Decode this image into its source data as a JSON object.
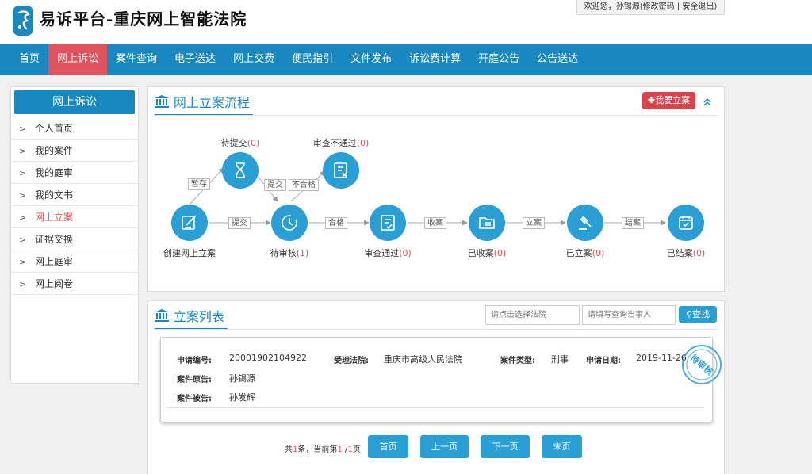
{
  "header": {
    "site_title": "易诉平台-重庆网上智能法院",
    "welcome_prefix": "欢迎您，孙锡源",
    "change_password": "(修改密码",
    "separator": " | ",
    "logout": "安全退出)"
  },
  "nav": {
    "items": [
      "首页",
      "网上诉讼",
      "案件查询",
      "电子送达",
      "网上交费",
      "便民指引",
      "文件发布",
      "诉讼费计算",
      "开庭公告",
      "公告送达"
    ],
    "active_index": 1
  },
  "sidebar": {
    "title": "网上诉讼",
    "items": [
      "个人首页",
      "我的案件",
      "我的庭审",
      "我的文书",
      "网上立案",
      "证据交换",
      "网上庭审",
      "网上阅卷"
    ],
    "active_index": 4
  },
  "flow_panel": {
    "title": "网上立案流程",
    "apply_button": "我要立案",
    "nodes": {
      "create": {
        "label": "创建网上立案",
        "count": ""
      },
      "to_submit": {
        "label": "待提交",
        "count": "(0)"
      },
      "review_fail": {
        "label": "审查不通过",
        "count": "(0)"
      },
      "pending_review": {
        "label": "待审核",
        "count": "(1)"
      },
      "review_pass": {
        "label": "审查通过",
        "count": "(0)"
      },
      "received": {
        "label": "已收案",
        "count": "(0)"
      },
      "filed": {
        "label": "已立案",
        "count": "(0)"
      },
      "closed": {
        "label": "已结案",
        "count": "(0)"
      }
    },
    "edges": {
      "save": "暂存",
      "submit_a": "提交",
      "submit_b": "提交",
      "fail": "不合格",
      "pass": "合格",
      "receive": "收案",
      "file": "立案",
      "close": "结案"
    }
  },
  "list_panel": {
    "title": "立案列表",
    "court_placeholder": "请点击选择法院",
    "party_placeholder": "请填写查询当事人",
    "search_button": "查找",
    "case": {
      "apply_no_label": "申请编号:",
      "apply_no": "20001902104922",
      "court_label": "受理法院:",
      "court": "重庆市高级人民法院",
      "type_label": "案件类型:",
      "type": "刑事",
      "date_label": "申请日期:",
      "date": "2019-11-26",
      "plaintiff_label": "案件原告:",
      "plaintiff": "孙锡源",
      "defendant_label": "案件被告:",
      "defendant": "孙发辉",
      "status_stamp": "待审核"
    }
  },
  "pagination": {
    "total_prefix": "共",
    "total": "1",
    "total_suffix": "条，当前第",
    "current": "1",
    "slash": " /",
    "pages": "1",
    "page_suffix": "页",
    "first": "首页",
    "prev": "上一页",
    "next": "下一页",
    "last": "末页"
  },
  "colors": {
    "primary": "#1a88c0",
    "node": "#2a9fd6",
    "accent_red": "#e0525d"
  }
}
